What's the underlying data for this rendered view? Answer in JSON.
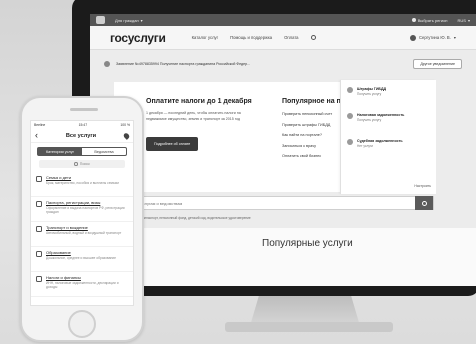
{
  "desktop": {
    "topbar": {
      "menu": "Для граждан",
      "region": "Выбрать регион",
      "lang": "RUS"
    },
    "header": {
      "logo": "госуслуги",
      "nav": [
        "Каталог услуг",
        "Помощь и поддержка",
        "Оплата"
      ],
      "user": "Сергутина Ю. В."
    },
    "banner": {
      "text": "Заявление №4978835994  Получение паспорта гражданина Российской Федер...",
      "button": "Другое уведомление"
    },
    "tax": {
      "title": "Оплатите налоги до 1 декабря",
      "text": "1 декабря — последний день, чтобы оплатить налоги на недвижимое имущество, землю и транспорт за 2015 год",
      "button": "Подробнее об оплате"
    },
    "popular": {
      "title": "Популярное на портале",
      "items": [
        "Проверить пенсионный счет",
        "Проверить штрафы ГИБДД",
        "Как найти на портале?",
        "Записаться к врачу",
        "Оплатить свой бизнес"
      ]
    },
    "notifications": {
      "items": [
        {
          "title": "Штрафы ГИБДД",
          "sub": "Получить услугу"
        },
        {
          "title": "Налоговая задолженность",
          "sub": "Получить услугу"
        },
        {
          "title": "Судебная задолженность",
          "sub": "Нет услуги"
        }
      ],
      "settings": "Настроить"
    },
    "search": {
      "placeholder": "Поиск по услугам и ведомствам",
      "tags": "Загранпаспорт, пенсионный фонд, детский сад, водительское удостоверение"
    },
    "popular_services_title": "Популярные услуги"
  },
  "phone": {
    "status": {
      "carrier": "Beeline",
      "time": "15:47",
      "battery": "100 %"
    },
    "title": "Все услуги",
    "tabs": [
      "Категории услуг",
      "Ведомства"
    ],
    "search_placeholder": "Поиск",
    "categories": [
      {
        "title": "Семья и дети",
        "sub": "Брак, материнство, пособия и выплаты семьям"
      },
      {
        "title": "Паспорта, регистрации, визы",
        "sub": "Оформление и выдача паспортов РФ, регистрации граждан"
      },
      {
        "title": "Транспорт и вождение",
        "sub": "Автомобильный, водный и воздушный транспорт"
      },
      {
        "title": "Образование",
        "sub": "Дошкольное, среднее и высшее образование"
      },
      {
        "title": "Налоги и финансы",
        "sub": "ИНН, налоговые задолженности, декларации и доходы"
      }
    ]
  }
}
